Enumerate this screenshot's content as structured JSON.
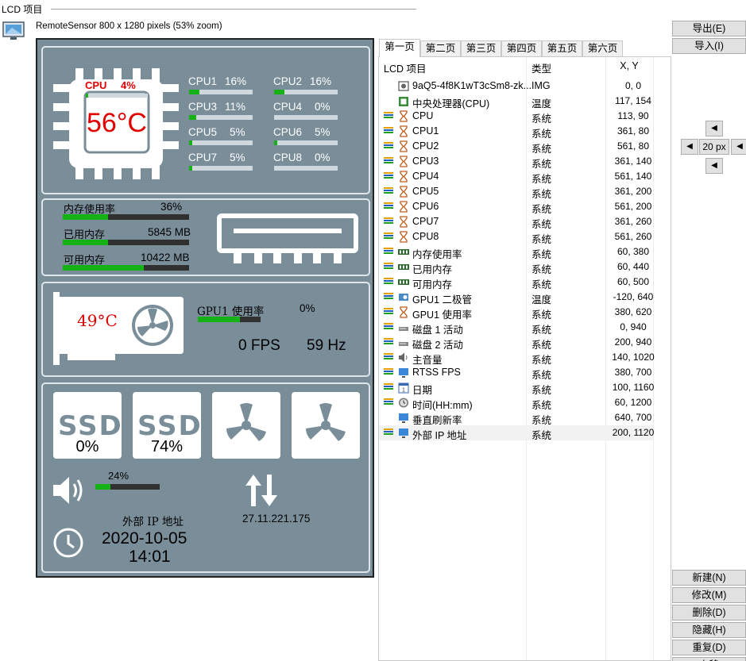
{
  "group": {
    "title": "LCD 项目"
  },
  "sensor": {
    "info": "RemoteSensor 800 x 1280 pixels (53% zoom)"
  },
  "lcd": {
    "cpu": {
      "label": "CPU",
      "load": "4%",
      "load_fraction": 0.04,
      "temp": "56°C",
      "cores": [
        {
          "label": "CPU1",
          "value": "16%",
          "fraction": 0.16
        },
        {
          "label": "CPU2",
          "value": "16%",
          "fraction": 0.16
        },
        {
          "label": "CPU3",
          "value": "11%",
          "fraction": 0.11
        },
        {
          "label": "CPU4",
          "value": "0%",
          "fraction": 0.0
        },
        {
          "label": "CPU5",
          "value": "5%",
          "fraction": 0.05
        },
        {
          "label": "CPU6",
          "value": "5%",
          "fraction": 0.05
        },
        {
          "label": "CPU7",
          "value": "5%",
          "fraction": 0.05
        },
        {
          "label": "CPU8",
          "value": "0%",
          "fraction": 0.0
        }
      ]
    },
    "memory": {
      "usage_label": "内存使用率",
      "usage_value": "36%",
      "usage_fraction": 0.36,
      "used_label": "已用内存",
      "used_value": "5845 MB",
      "used_fraction": 0.36,
      "free_label": "可用内存",
      "free_value": "10422 MB",
      "free_fraction": 0.64
    },
    "gpu": {
      "temp": "49°C",
      "usage_label": "GPU1 使用率",
      "usage_value": "0%",
      "usage_fraction": 0.67,
      "fps": "0 FPS",
      "refresh": "59 Hz"
    },
    "disks": [
      {
        "label": "SSD",
        "value": "0%"
      },
      {
        "label": "SSD",
        "value": "74%"
      }
    ],
    "volume": {
      "value": "24%",
      "fraction": 0.24
    },
    "ip": {
      "label": "外部 IP 地址",
      "value": "27.11.221.175"
    },
    "datetime": {
      "date": "2020-10-05",
      "time": "14:01"
    }
  },
  "tabs": [
    "第一页",
    "第二页",
    "第三页",
    "第四页",
    "第五页",
    "第六页"
  ],
  "list": {
    "headers": {
      "name": "LCD 项目",
      "type": "类型",
      "xy": "X, Y"
    },
    "rows": [
      {
        "name": "9aQ5-4f8K1wT3cSm8-zk...",
        "type": "IMG",
        "xy": "0, 0",
        "lines": false,
        "icon": "image-icon"
      },
      {
        "name": "中央处理器(CPU)",
        "type": "温度",
        "xy": "117, 154",
        "lines": false,
        "icon": "chip-icon"
      },
      {
        "name": "CPU",
        "type": "系统",
        "xy": "113, 90",
        "lines": true,
        "icon": "hourglass-icon"
      },
      {
        "name": "CPU1",
        "type": "系统",
        "xy": "361, 80",
        "lines": true,
        "icon": "hourglass-icon"
      },
      {
        "name": "CPU2",
        "type": "系统",
        "xy": "561, 80",
        "lines": true,
        "icon": "hourglass-icon"
      },
      {
        "name": "CPU3",
        "type": "系统",
        "xy": "361, 140",
        "lines": true,
        "icon": "hourglass-icon"
      },
      {
        "name": "CPU4",
        "type": "系统",
        "xy": "561, 140",
        "lines": true,
        "icon": "hourglass-icon"
      },
      {
        "name": "CPU5",
        "type": "系统",
        "xy": "361, 200",
        "lines": true,
        "icon": "hourglass-icon"
      },
      {
        "name": "CPU6",
        "type": "系统",
        "xy": "561, 200",
        "lines": true,
        "icon": "hourglass-icon"
      },
      {
        "name": "CPU7",
        "type": "系统",
        "xy": "361, 260",
        "lines": true,
        "icon": "hourglass-icon"
      },
      {
        "name": "CPU8",
        "type": "系统",
        "xy": "561, 260",
        "lines": true,
        "icon": "hourglass-icon"
      },
      {
        "name": "内存使用率",
        "type": "系统",
        "xy": "60, 380",
        "lines": true,
        "icon": "ram-icon"
      },
      {
        "name": "已用内存",
        "type": "系统",
        "xy": "60, 440",
        "lines": true,
        "icon": "ram-icon"
      },
      {
        "name": "可用内存",
        "type": "系统",
        "xy": "60, 500",
        "lines": true,
        "icon": "ram-icon"
      },
      {
        "name": "GPU1 二极管",
        "type": "温度",
        "xy": "-120, 640",
        "lines": true,
        "icon": "gpu-icon"
      },
      {
        "name": "GPU1 使用率",
        "type": "系统",
        "xy": "380, 620",
        "lines": true,
        "icon": "hourglass-icon"
      },
      {
        "name": "磁盘 1 活动",
        "type": "系统",
        "xy": "0, 940",
        "lines": true,
        "icon": "disk-icon"
      },
      {
        "name": "磁盘 2 活动",
        "type": "系统",
        "xy": "200, 940",
        "lines": true,
        "icon": "disk-icon"
      },
      {
        "name": "主音量",
        "type": "系统",
        "xy": "140, 1020",
        "lines": true,
        "icon": "speaker-icon"
      },
      {
        "name": "RTSS FPS",
        "type": "系统",
        "xy": "380, 700",
        "lines": true,
        "icon": "monitor-icon"
      },
      {
        "name": "日期",
        "type": "系统",
        "xy": "100, 1160",
        "lines": true,
        "icon": "calendar-icon"
      },
      {
        "name": "时间(HH:mm)",
        "type": "系统",
        "xy": "60, 1200",
        "lines": true,
        "icon": "clock-icon"
      },
      {
        "name": "垂直刷新率",
        "type": "系统",
        "xy": "640, 700",
        "lines": false,
        "icon": "monitor-icon"
      },
      {
        "name": "外部 IP 地址",
        "type": "系统",
        "xy": "200, 1120",
        "lines": true,
        "icon": "monitor-icon"
      }
    ]
  },
  "buttons": {
    "export": "导出(E)",
    "import": "导入(I)",
    "step": "20 px",
    "new": "新建(N)",
    "modify": "修改(M)",
    "delete": "删除(D)",
    "hide": "隐藏(H)",
    "duplicate": "重复(D)",
    "partial": "上移"
  },
  "colors": {
    "lcd_bg": "#7a8e9a",
    "bar_fill": "#14b214",
    "temp_red": "#e00000",
    "line_orange": "#e8a000",
    "line_blue": "#2060c0",
    "line_green": "#20a020"
  }
}
